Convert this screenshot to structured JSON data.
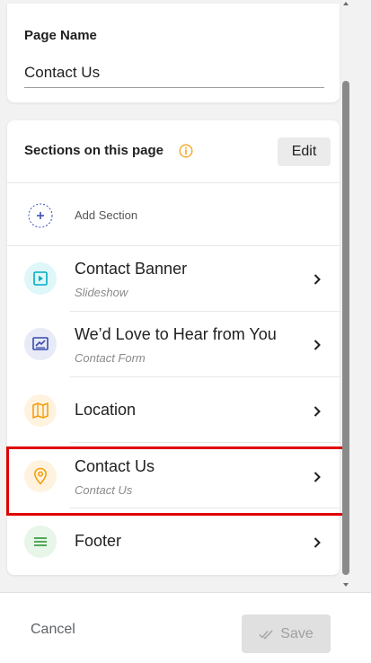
{
  "page_name": {
    "label": "Page Name",
    "value": "Contact Us"
  },
  "sections": {
    "title": "Sections on this page",
    "edit_label": "Edit",
    "add_label": "Add Section",
    "items": [
      {
        "title": "Contact Banner",
        "subtitle": "Slideshow",
        "icon": "slideshow-icon",
        "bg": "#e0f7fa",
        "fg": "#00acc1"
      },
      {
        "title": "We’d Love to Hear from You",
        "subtitle": "Contact Form",
        "icon": "contact-form-icon",
        "bg": "#e8eaf6",
        "fg": "#3949ab"
      },
      {
        "title": "Location",
        "subtitle": "",
        "icon": "map-icon",
        "bg": "#fff3e0",
        "fg": "#f59e0b"
      },
      {
        "title": "Contact Us",
        "subtitle": "Contact Us",
        "icon": "location-pin-icon",
        "bg": "#fff3e0",
        "fg": "#f59e0b"
      },
      {
        "title": "Footer",
        "subtitle": "",
        "icon": "footer-icon",
        "bg": "#e8f5e9",
        "fg": "#43a047"
      }
    ]
  },
  "footer": {
    "cancel_label": "Cancel",
    "save_label": "Save"
  },
  "colors": {
    "highlight": "#e00000",
    "info": "#f5a623"
  }
}
